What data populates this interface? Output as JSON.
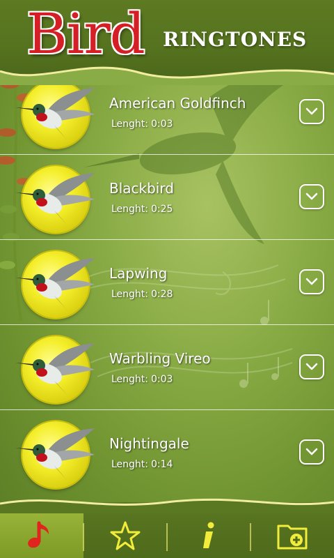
{
  "header": {
    "title_main": "Bird",
    "title_sub": "RINGTONES"
  },
  "ringtones": [
    {
      "name": "American Goldfinch",
      "length_label": "Lenght:",
      "length": "0:03"
    },
    {
      "name": "Blackbird",
      "length_label": "Lenght:",
      "length": "0:25"
    },
    {
      "name": "Lapwing",
      "length_label": "Lenght:",
      "length": "0:28"
    },
    {
      "name": "Warbling Vireo",
      "length_label": "Lenght:",
      "length": "0:03"
    },
    {
      "name": "Nightingale",
      "length_label": "Lenght:",
      "length": "0:14"
    }
  ],
  "tabs": [
    {
      "icon": "music-note-icon",
      "active": true
    },
    {
      "icon": "star-icon",
      "active": false
    },
    {
      "icon": "info-icon",
      "active": false
    },
    {
      "icon": "folder-add-icon",
      "active": false
    }
  ],
  "colors": {
    "title_red": "#d41f27",
    "thumb_yellow": "#f4ee2a",
    "accent_yellow": "#e6e16a",
    "active_red": "#e0241e"
  }
}
